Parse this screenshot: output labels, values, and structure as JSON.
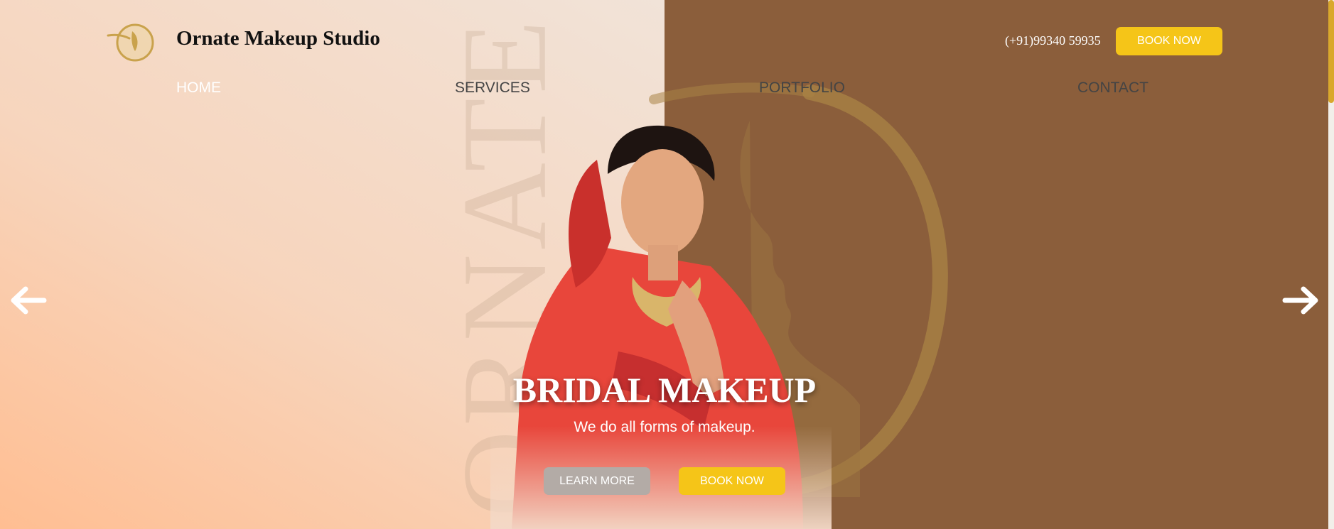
{
  "header": {
    "brand_name": "Ornate Makeup Studio",
    "phone": "(+91)99340 59935",
    "book_now_label": "BOOK NOW"
  },
  "nav": {
    "items": [
      {
        "label": "HOME",
        "active": true
      },
      {
        "label": "SERVICES",
        "active": false
      },
      {
        "label": "PORTFOLIO",
        "active": false
      },
      {
        "label": "CONTACT",
        "active": false
      }
    ]
  },
  "hero": {
    "watermark_text": "ORNATE",
    "title": "BRIDAL MAKEUP",
    "subtitle": "We do all forms of makeup.",
    "learn_more_label": "LEARN MORE",
    "book_now_label": "BOOK NOW"
  },
  "carousel": {
    "prev_icon": "arrow-left-icon",
    "next_icon": "arrow-right-icon"
  },
  "colors": {
    "accent_yellow": "#f5c518",
    "panel_brown": "#8b5e3b",
    "ring_gold": "#b08a4a",
    "button_grey": "#b3aba6"
  }
}
